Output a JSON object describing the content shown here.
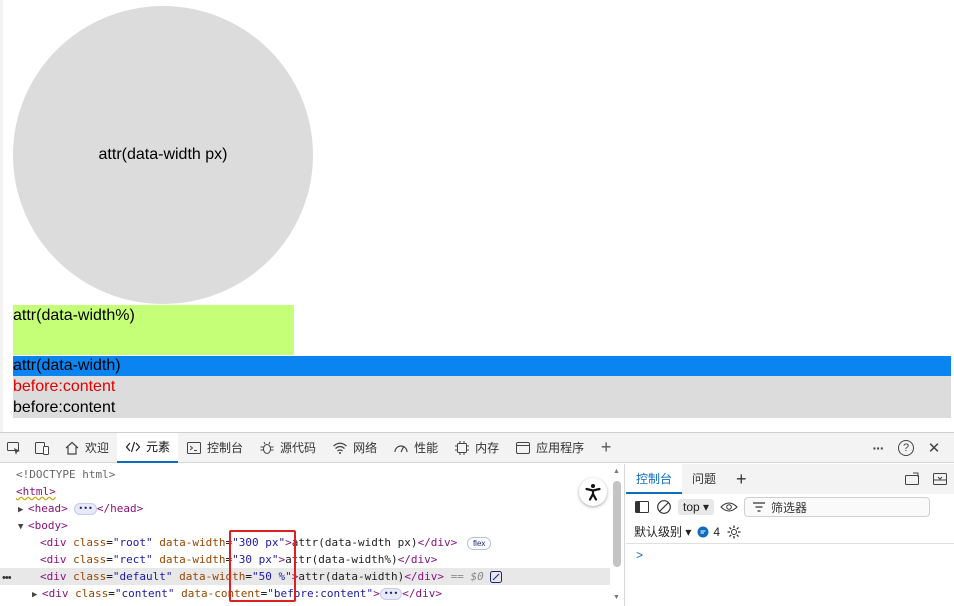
{
  "page": {
    "root_text": "attr(data-width px)",
    "rect_text": "attr(data-width%)",
    "default_text": "attr(data-width)",
    "content_red": "before:content",
    "content_black": "before:content"
  },
  "devtools": {
    "tabs": [
      {
        "label": "欢迎",
        "icon": "home-icon"
      },
      {
        "label": "元素",
        "icon": "code-icon"
      },
      {
        "label": "控制台",
        "icon": "console-icon"
      },
      {
        "label": "源代码",
        "icon": "bug-icon"
      },
      {
        "label": "网络",
        "icon": "wifi-icon"
      },
      {
        "label": "性能",
        "icon": "gauge-icon"
      },
      {
        "label": "内存",
        "icon": "chip-icon"
      },
      {
        "label": "应用程序",
        "icon": "window-icon"
      }
    ],
    "add_tab": "+",
    "more": "···",
    "help": "?",
    "close": "✕"
  },
  "elements": {
    "doctype": "<!DOCTYPE html>",
    "html_open": "<html>",
    "head_open": "<head>",
    "head_close": "</head>",
    "body_open": "<body>",
    "rows": [
      {
        "class_val": "\"root\"",
        "dw_val": "\"300 px\"",
        "text": "attr(data-width px)",
        "close": "</div>",
        "badge": "flex"
      },
      {
        "class_val": "\"rect\"",
        "dw_val": "\"30 px\"",
        "text": "attr(data-width%)",
        "close": "</div>"
      },
      {
        "class_val": "\"default\"",
        "dw_val": "\"50 %\"",
        "text": "attr(data-width)",
        "close": "</div>",
        "eq": "== $0"
      }
    ],
    "content_row": {
      "class_val": "\"content\"",
      "attr": "data-content",
      "attr_val": "\"before:content\"",
      "close": "</div>"
    },
    "attr_class": "class",
    "attr_dw": "data-width",
    "div_open": "<div",
    "gt": ">",
    "ellipsis": "•••"
  },
  "console": {
    "tab_active": "控制台",
    "tab_issues": "问题",
    "add": "+",
    "context": "top",
    "filter_placeholder": "筛选器",
    "levels": "默认级别",
    "issues_count": "4",
    "prompt": ">"
  },
  "colors": {
    "circle": "#dcdcdc",
    "rect": "#c5ff78",
    "default": "#0a84f0",
    "content": "#dcdcdc",
    "red_text": "#e00000",
    "highlight_box": "#e02020"
  }
}
